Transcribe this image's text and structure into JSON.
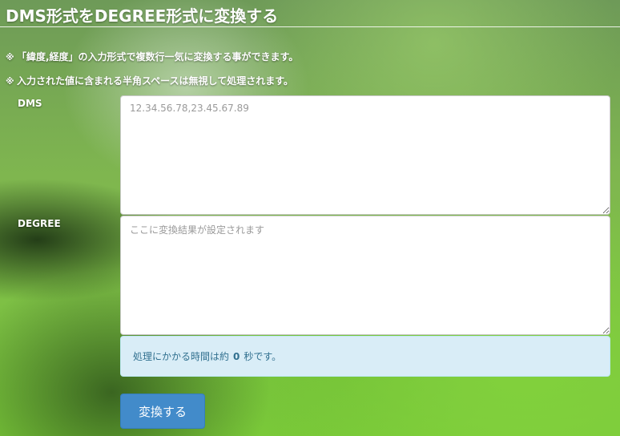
{
  "page": {
    "title": "DMS形式をDEGREE形式に変換する"
  },
  "notes": [
    {
      "mark": "※",
      "text": "「緯度,経度」の入力形式で複数行一気に変換する事ができます。"
    },
    {
      "mark": "※",
      "text": "入力された値に含まれる半角スペースは無視して処理されます。"
    }
  ],
  "form": {
    "dms": {
      "label": "DMS",
      "value": "",
      "placeholder": "12.34.56.78,23.45.67.89"
    },
    "degree": {
      "label": "DEGREE",
      "value": "",
      "placeholder": "ここに変換結果が設定されます"
    },
    "info": {
      "prefix": "処理にかかる時間は約",
      "seconds": "0",
      "suffix": "秒です。"
    },
    "convert_button": "変換する"
  },
  "colors": {
    "info_background": "#d9edf7",
    "info_text": "#31708f",
    "button_background": "#428bca",
    "button_text": "#ffffff"
  }
}
